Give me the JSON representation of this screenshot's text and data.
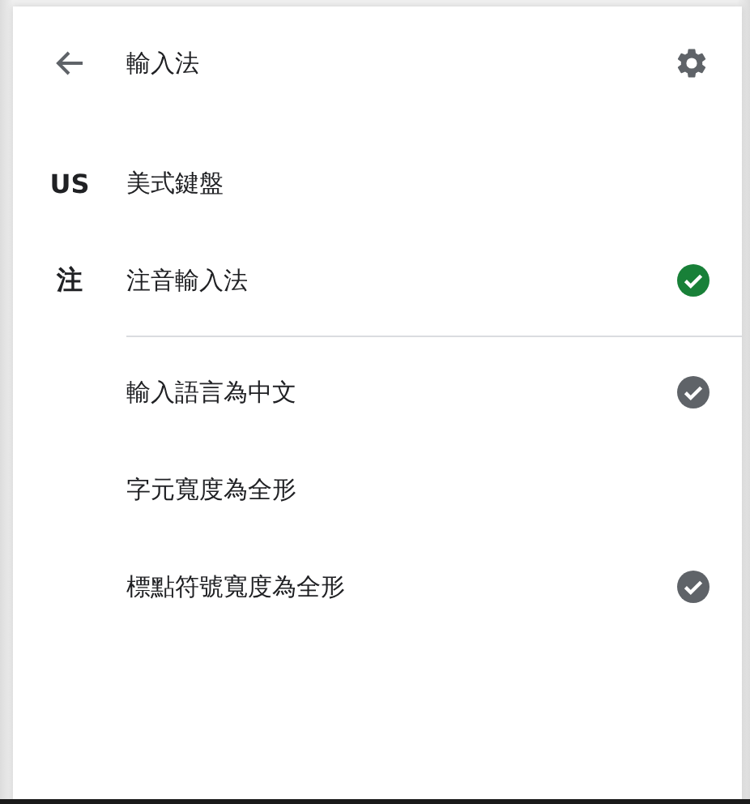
{
  "header": {
    "title": "輸入法"
  },
  "input_methods": [
    {
      "badge": "US",
      "name": "美式鍵盤",
      "selected": false
    },
    {
      "badge": "注",
      "name": "注音輸入法",
      "selected": true
    }
  ],
  "options": [
    {
      "label": "輸入語言為中文",
      "checked": true
    },
    {
      "label": "字元寬度為全形",
      "checked": false
    },
    {
      "label": "標點符號寬度為全形",
      "checked": true
    }
  ]
}
